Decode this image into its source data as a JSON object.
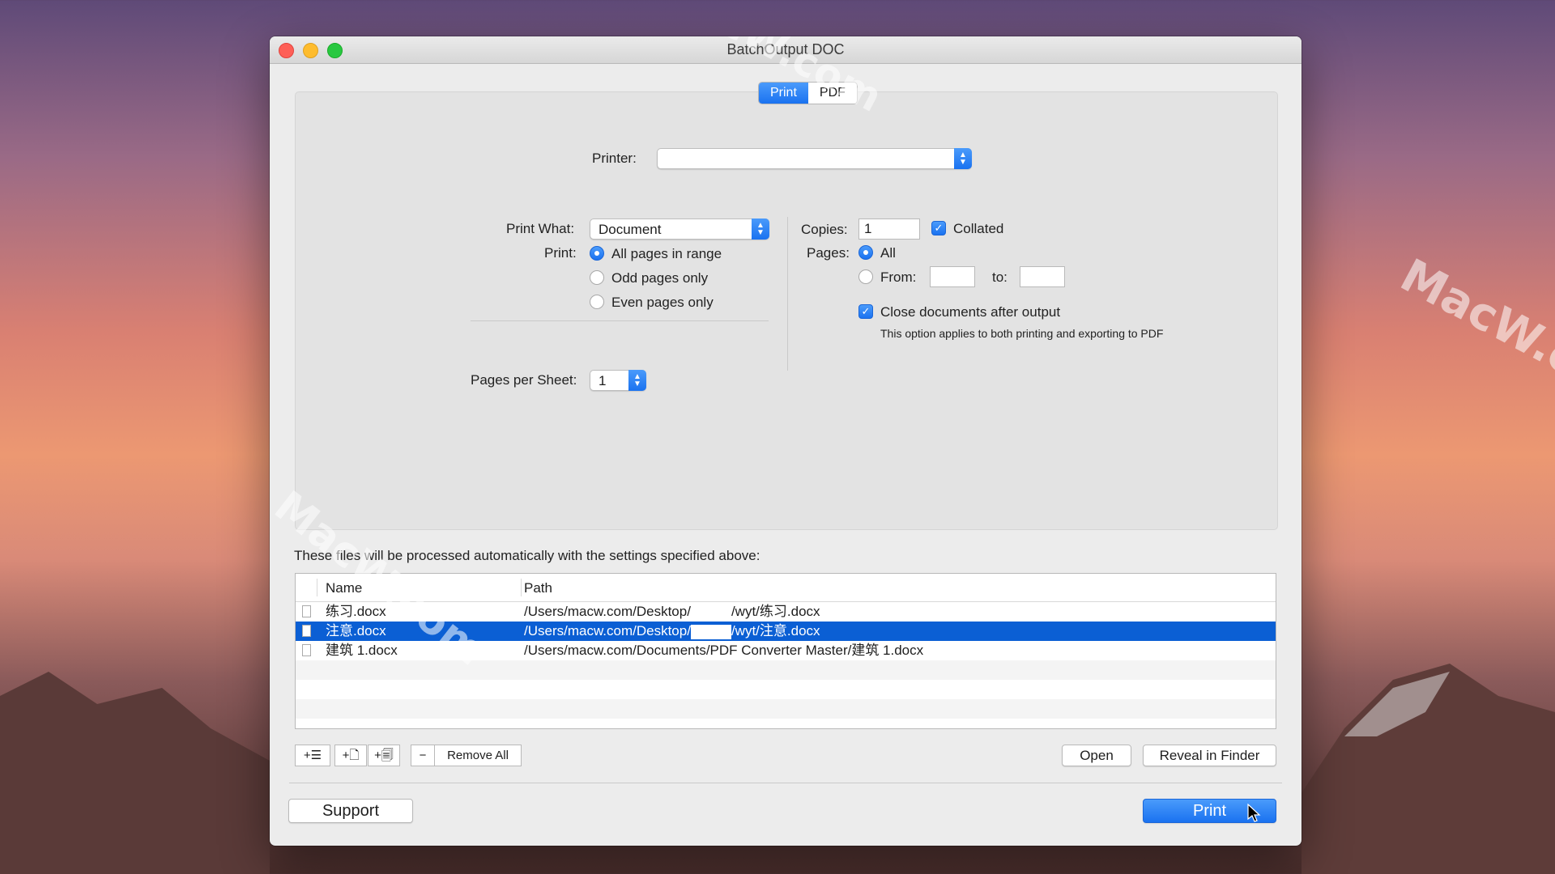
{
  "window": {
    "title": "BatchOutput DOC"
  },
  "tabs": [
    {
      "label": "Print",
      "active": true
    },
    {
      "label": "PDF",
      "active": false
    }
  ],
  "printer": {
    "label": "Printer:",
    "value": ""
  },
  "print_what": {
    "label": "Print What:",
    "value": "Document"
  },
  "print_range": {
    "label": "Print:",
    "options": [
      {
        "label": "All pages in range",
        "selected": true
      },
      {
        "label": "Odd pages only",
        "selected": false
      },
      {
        "label": "Even pages only",
        "selected": false
      }
    ]
  },
  "pages_per_sheet": {
    "label": "Pages per Sheet:",
    "value": "1"
  },
  "copies": {
    "label": "Copies:",
    "value": "1",
    "collated_label": "Collated",
    "collated": true
  },
  "pages": {
    "label": "Pages:",
    "all_label": "All",
    "from_label": "From:",
    "to_label": "to:",
    "from_value": "",
    "to_value": ""
  },
  "close_docs": {
    "label": "Close documents after output",
    "checked": true,
    "note": "This option applies to both printing and exporting to PDF"
  },
  "files": {
    "caption": "These files will be processed automatically with the settings specified above:",
    "columns": {
      "name": "Name",
      "path": "Path"
    },
    "rows": [
      {
        "name": "练习.docx",
        "path_a": "/Users/macw.com/Desktop/",
        "path_b": "/wyt/练习.docx"
      },
      {
        "name": "注意.docx",
        "path_a": "/Users/macw.com/Desktop/",
        "path_b": "/wyt/注意.docx"
      },
      {
        "name": "建筑 1.docx",
        "path_a": "/Users/macw.com/Documents/PDF Converter Master/建筑 1.docx",
        "path_b": ""
      }
    ]
  },
  "toolbar": {
    "remove_all": "Remove All",
    "open": "Open",
    "reveal": "Reveal in Finder"
  },
  "footer": {
    "support": "Support",
    "print": "Print"
  },
  "watermarks": {
    "a": "MacW.com",
    "b": "MacW.c",
    "c": "MacW.com"
  },
  "colors": {
    "accent": "#1a72f0",
    "selection": "#0b5fd4"
  }
}
